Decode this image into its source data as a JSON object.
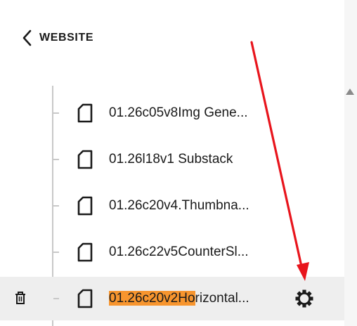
{
  "header": {
    "back_label": "WEBSITE",
    "back_icon": "chevron-left-icon"
  },
  "pages": [
    {
      "label": "01.26c05v8Img Gene...",
      "icon": "page-icon"
    },
    {
      "label": "01.26l18v1 Substack",
      "icon": "page-icon"
    },
    {
      "label": "01.26c20v4.Thumbna...",
      "icon": "page-icon"
    },
    {
      "label": "01.26c22v5CounterSl...",
      "icon": "page-icon"
    },
    {
      "label": "01.26c20v2Horizontal...",
      "label_highlight": "01.26c20v2Ho",
      "label_rest": "rizontal...",
      "icon": "page-icon",
      "selected": true,
      "actions": [
        "trash-icon",
        "gear-icon"
      ]
    }
  ],
  "colors": {
    "highlight": "#f7952e",
    "annotation_arrow": "#e8141c",
    "selected_row": "#eeeeee"
  },
  "annotation": {
    "type": "arrow",
    "points_to": "gear-icon"
  }
}
